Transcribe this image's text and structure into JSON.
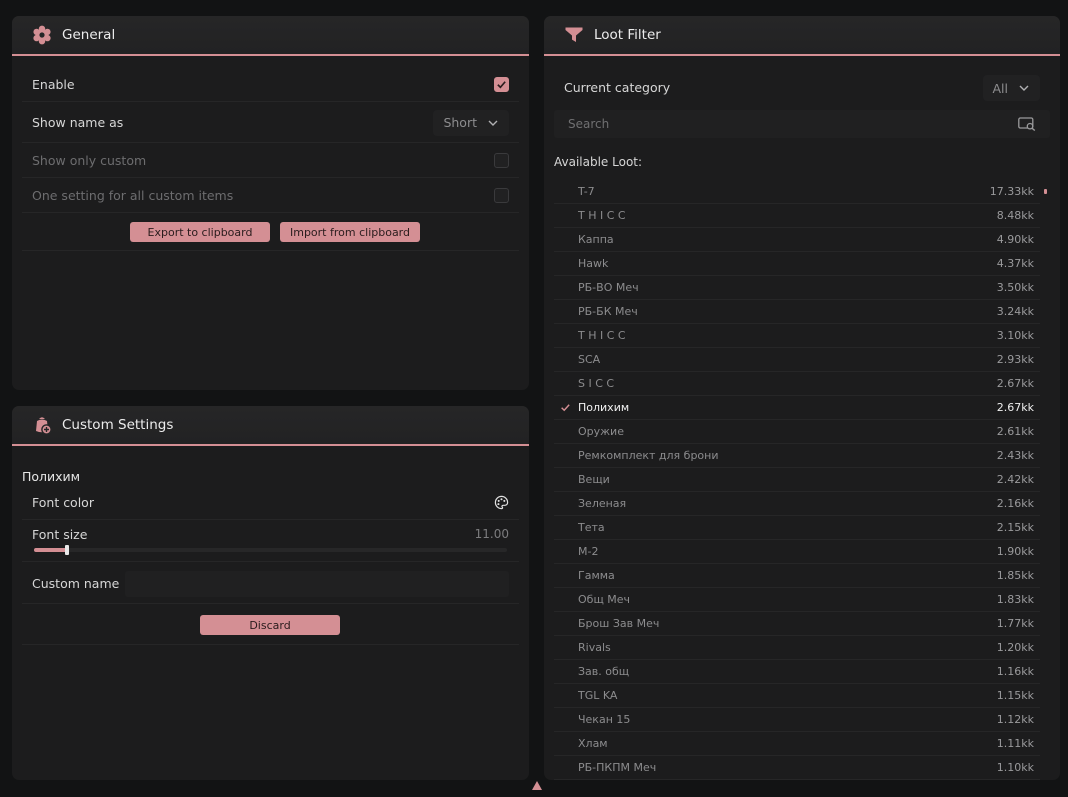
{
  "general": {
    "title": "General",
    "enable_label": "Enable",
    "enable_checked": true,
    "show_name_label": "Show name as",
    "show_name_value": "Short",
    "show_only_custom_label": "Show only custom",
    "one_setting_label": "One setting for all custom items",
    "export_label": "Export to clipboard",
    "import_label": "Import from clipboard"
  },
  "custom": {
    "title": "Custom Settings",
    "item_name": "Полихим",
    "font_color_label": "Font color",
    "font_size_label": "Font size",
    "font_size_value": "11.00",
    "font_size_fraction": 0.07,
    "custom_name_label": "Custom name",
    "custom_name_value": "",
    "discard_label": "Discard"
  },
  "loot": {
    "title": "Loot Filter",
    "category_label": "Current category",
    "category_value": "All",
    "search_placeholder": "Search",
    "available_label": "Available Loot:",
    "items": [
      {
        "name": "T-7",
        "value": "17.33kk",
        "selected": false
      },
      {
        "name": "T H I C C",
        "value": "8.48kk",
        "selected": false
      },
      {
        "name": "Каппа",
        "value": "4.90kk",
        "selected": false
      },
      {
        "name": "Hawk",
        "value": "4.37kk",
        "selected": false
      },
      {
        "name": "РБ-ВО Меч",
        "value": "3.50kk",
        "selected": false
      },
      {
        "name": "РБ-БК Меч",
        "value": "3.24kk",
        "selected": false
      },
      {
        "name": "T H I C C",
        "value": "3.10kk",
        "selected": false
      },
      {
        "name": "SCA",
        "value": "2.93kk",
        "selected": false
      },
      {
        "name": "S I C C",
        "value": "2.67kk",
        "selected": false
      },
      {
        "name": "Полихим",
        "value": "2.67kk",
        "selected": true
      },
      {
        "name": "Оружие",
        "value": "2.61kk",
        "selected": false
      },
      {
        "name": "Ремкомплект для брони",
        "value": "2.43kk",
        "selected": false
      },
      {
        "name": "Вещи",
        "value": "2.42kk",
        "selected": false
      },
      {
        "name": "Зеленая",
        "value": "2.16kk",
        "selected": false
      },
      {
        "name": "Тета",
        "value": "2.15kk",
        "selected": false
      },
      {
        "name": "М-2",
        "value": "1.90kk",
        "selected": false
      },
      {
        "name": "Гамма",
        "value": "1.85kk",
        "selected": false
      },
      {
        "name": "Общ Меч",
        "value": "1.83kk",
        "selected": false
      },
      {
        "name": "Брош Зав Меч",
        "value": "1.77kk",
        "selected": false
      },
      {
        "name": "Rivals",
        "value": "1.20kk",
        "selected": false
      },
      {
        "name": "Зав. общ",
        "value": "1.16kk",
        "selected": false
      },
      {
        "name": "TGL KA",
        "value": "1.15kk",
        "selected": false
      },
      {
        "name": "Чекан 15",
        "value": "1.12kk",
        "selected": false
      },
      {
        "name": "Хлам",
        "value": "1.11kk",
        "selected": false
      },
      {
        "name": "РБ-ПКПМ Меч",
        "value": "1.10kk",
        "selected": false
      }
    ]
  },
  "colors": {
    "accent": "#d48f94",
    "panel": "#1c1c1d",
    "background": "#121314"
  }
}
